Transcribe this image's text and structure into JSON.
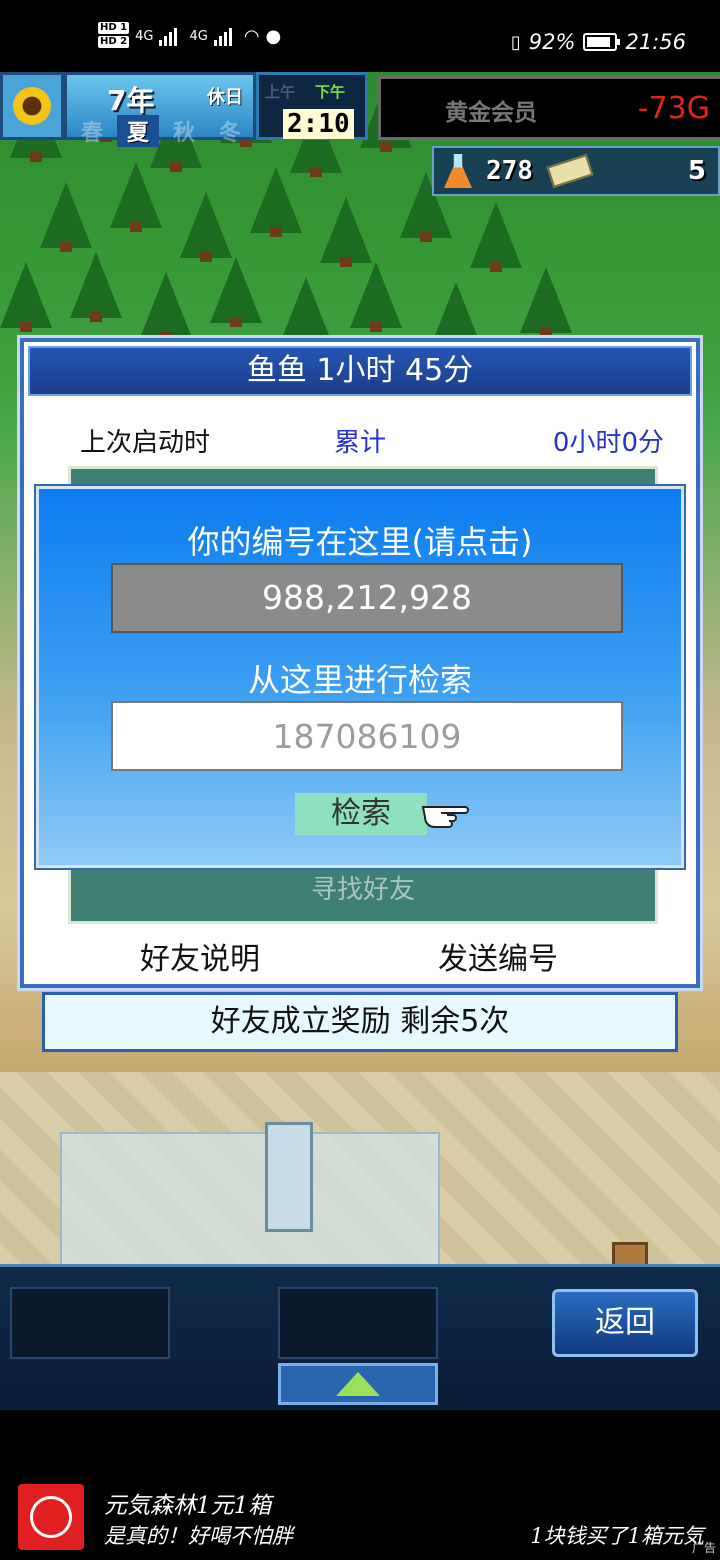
{
  "status_bar": {
    "hd1": "HD 1",
    "hd2": "HD 2",
    "net1": "4G",
    "net2": "4G",
    "battery_percent": "92%",
    "time": "21:56"
  },
  "hud": {
    "year": "7年",
    "holiday": "休日",
    "seasons": [
      "春",
      "夏",
      "秋",
      "冬"
    ],
    "active_season": "夏",
    "am_label": "上午",
    "pm_label": "下午",
    "clock": "2:10",
    "member_label": "黄金会员",
    "money": "-73G",
    "research_points": "278",
    "tickets": "5"
  },
  "panel": {
    "title": "鱼鱼  1小时 45分",
    "last_start_label": "上次启动时",
    "total_label": "累计",
    "total_value": "0小时0分",
    "find_friend": "寻找好友",
    "friend_help": "好友说明",
    "send_id": "发送编号"
  },
  "reward_bar": "好友成立奖励  剩余5次",
  "dialog": {
    "your_id_label": "你的编号在这里(请点击)",
    "your_id": "988,212,928",
    "search_label": "从这里进行检索",
    "search_value": "187086109",
    "search_button": "检索"
  },
  "bottom_bar": {
    "return_button": "返回"
  },
  "ad": {
    "title": "元気森林1元1箱",
    "subtitle": "是真的！好喝不怕胖",
    "right_text": "1块钱买了1箱元気",
    "tag": "广告"
  },
  "colors": {
    "dialog_blue": "#0b7cf0",
    "panel_title_blue": "#2455b2",
    "money_red": "#e02222",
    "teal": "#3f7e73",
    "search_btn": "#8fe0bf"
  }
}
